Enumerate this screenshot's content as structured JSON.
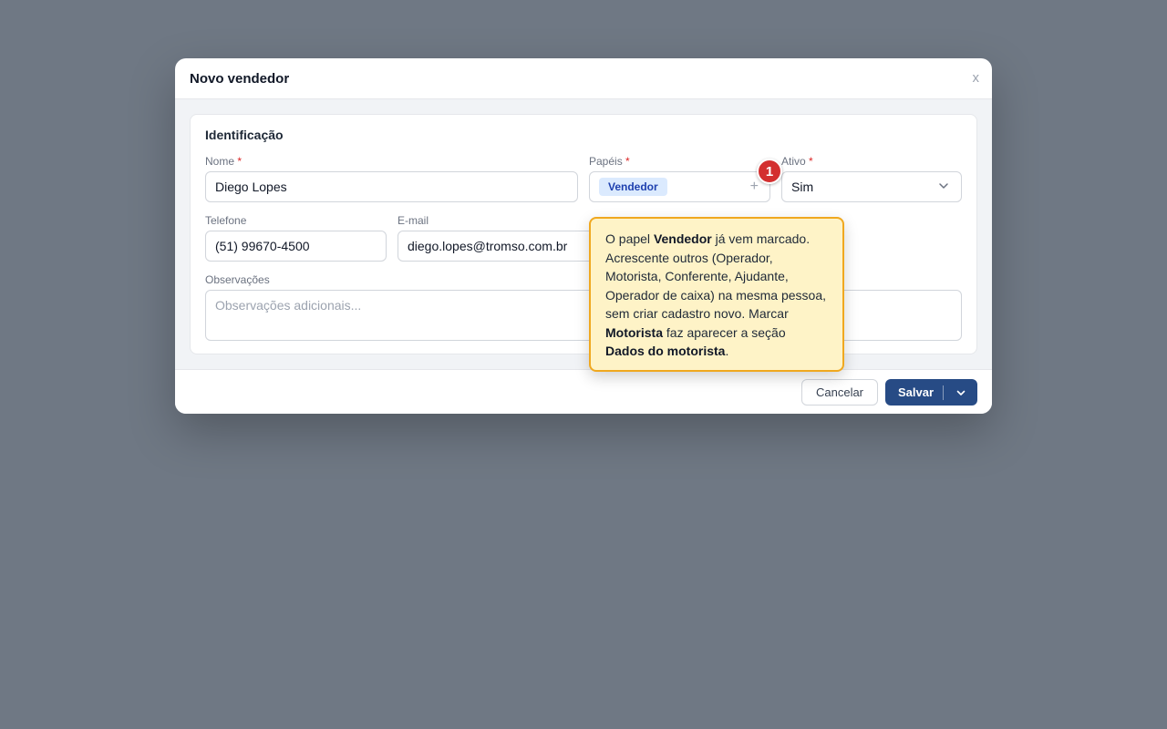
{
  "modal": {
    "title": "Novo vendedor",
    "close_label": "x"
  },
  "section": {
    "title": "Identificação"
  },
  "fields": {
    "nome": {
      "label": "Nome",
      "required": "*",
      "value": "Diego Lopes"
    },
    "papeis": {
      "label": "Papéis",
      "required": "*",
      "chip": "Vendedor",
      "add": "+"
    },
    "ativo": {
      "label": "Ativo",
      "required": "*",
      "value": "Sim"
    },
    "telefone": {
      "label": "Telefone",
      "value": "(51) 99670-4500"
    },
    "email": {
      "label": "E-mail",
      "value": "diego.lopes@tromso.com.br"
    },
    "observacoes": {
      "label": "Observações",
      "placeholder": "Observações adicionais..."
    }
  },
  "footer": {
    "cancel_label": "Cancelar",
    "save_label": "Salvar"
  },
  "tour": {
    "step": "1",
    "t1": "O papel ",
    "b1": "Vendedor",
    "t2": " já vem marcado. Acrescente outros (Operador, Motorista, Conferente, Ajudante, Operador de caixa) na mesma pessoa, sem criar cadastro novo. Marcar ",
    "b2": "Motorista",
    "t3": " faz aparecer a seção ",
    "b3": "Dados do motorista",
    "t4": "."
  },
  "colors": {
    "primary": "#274b85",
    "required": "#dc2626",
    "tooltip_bg": "#fef3c7",
    "tooltip_border": "#f0a81f",
    "badge": "#d32f2f"
  },
  "icons": {
    "close": "close-icon",
    "add": "plus-icon",
    "select": "chevron-down-icon",
    "dropdown": "chevron-down-icon"
  }
}
